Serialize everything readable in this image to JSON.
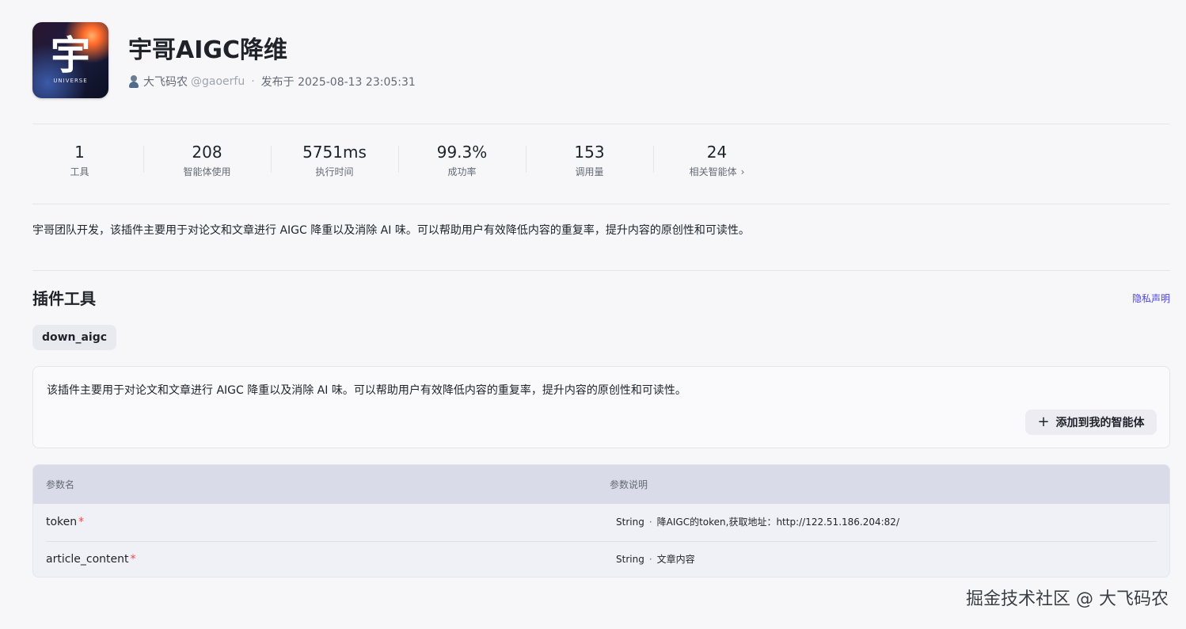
{
  "header": {
    "logo_glyph": "宇",
    "logo_subtext": "UNIVERSE",
    "title": "宇哥AIGC降维",
    "author": "大飞码农",
    "handle": "@gaoerfu",
    "separator": "·",
    "published": "发布于 2025-08-13 23:05:31"
  },
  "stats": [
    {
      "value": "1",
      "label": "工具"
    },
    {
      "value": "208",
      "label": "智能体使用"
    },
    {
      "value": "5751ms",
      "label": "执行时间"
    },
    {
      "value": "99.3%",
      "label": "成功率"
    },
    {
      "value": "153",
      "label": "调用量"
    },
    {
      "value": "24",
      "label": "相关智能体"
    }
  ],
  "description": "宇哥团队开发，该插件主要用于对论文和文章进行 AIGC 降重以及消除 AI 味。可以帮助用户有效降低内容的重复率，提升内容的原创性和可读性。",
  "tools_section": {
    "title": "插件工具",
    "privacy_link": "隐私声明",
    "tab_label": "down_aigc",
    "tool_description": "该插件主要用于对论文和文章进行 AIGC 降重以及消除 AI 味。可以帮助用户有效降低内容的重复率，提升内容的原创性和可读性。",
    "add_button_icon": "+",
    "add_button_label": "添加到我的智能体"
  },
  "params": {
    "header_name": "参数名",
    "header_desc": "参数说明",
    "rows": [
      {
        "name": "token",
        "required_mark": "*",
        "type": "String",
        "sep": "·",
        "desc": "降AIGC的token,获取地址：http://122.51.186.204:82/"
      },
      {
        "name": "article_content",
        "required_mark": "*",
        "type": "String",
        "sep": "·",
        "desc": "文章内容"
      }
    ]
  },
  "watermark": "掘金技术社区 @ 大飞码农",
  "colors": {
    "background": "#f7f7fa",
    "link": "#4e40e5",
    "required": "#f54a45",
    "table_header": "#d9dce8"
  }
}
